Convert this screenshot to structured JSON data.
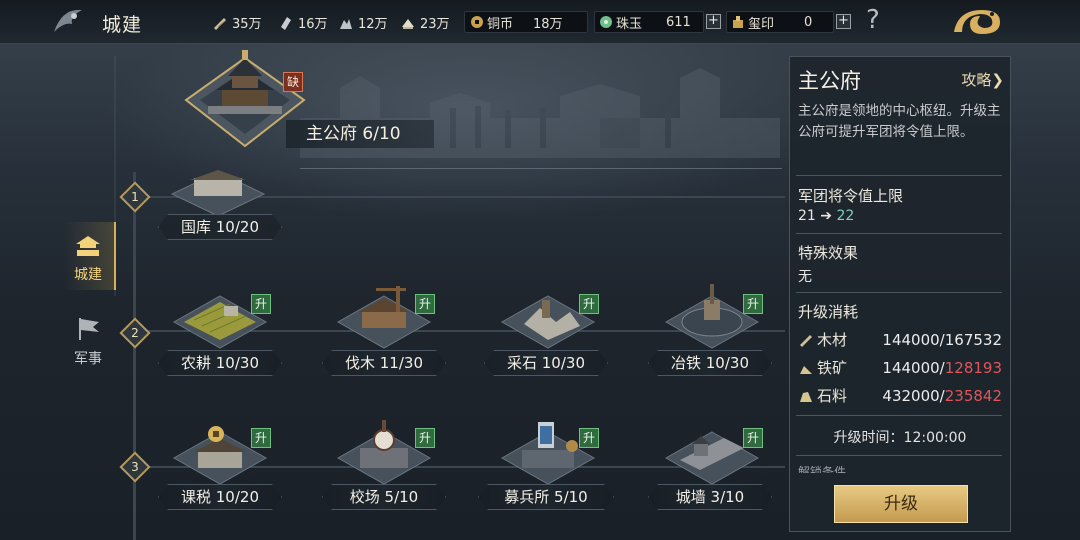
{
  "header": {
    "title": "城建",
    "resources": [
      {
        "icon": "wood-icon",
        "value": "35万"
      },
      {
        "icon": "iron-icon",
        "value": "16万"
      },
      {
        "icon": "stone-icon",
        "value": "12万"
      },
      {
        "icon": "grain-icon",
        "value": "23万"
      }
    ],
    "copper": {
      "label": "铜币",
      "value": "18万"
    },
    "jade": {
      "label": "珠玉",
      "value": "611"
    },
    "seal": {
      "label": "玺印",
      "value": "0"
    },
    "plus": "+",
    "help": "?"
  },
  "tabs": [
    {
      "label": "城建",
      "icon": "city-icon",
      "active": true
    },
    {
      "label": "军事",
      "icon": "flag-icon",
      "active": false
    }
  ],
  "main_building": {
    "label": "主公府 6/10",
    "badge": "缺"
  },
  "tiers": [
    "1",
    "2",
    "3"
  ],
  "buildings": [
    {
      "label": "国库 10/20",
      "badge": ""
    },
    {
      "label": "农耕 10/30",
      "badge": "升"
    },
    {
      "label": "伐木 11/30",
      "badge": "升"
    },
    {
      "label": "采石 10/30",
      "badge": "升"
    },
    {
      "label": "冶铁 10/30",
      "badge": "升"
    },
    {
      "label": "课税 10/20",
      "badge": "升"
    },
    {
      "label": "校场 5/10",
      "badge": "升"
    },
    {
      "label": "募兵所 5/10",
      "badge": "升"
    },
    {
      "label": "城墙 3/10",
      "badge": "升"
    }
  ],
  "panel": {
    "title": "主公府",
    "guide": "攻略",
    "guide_arrow": "❯",
    "description": "主公府是领地的中心枢纽。升级主公府可提升军团将令值上限。",
    "stat_heading": "军团将令值上限",
    "stat_from": "21",
    "stat_arrow": "➔",
    "stat_to": "22",
    "effect_heading": "特殊效果",
    "effect_value": "无",
    "cost_heading": "升级消耗",
    "costs": [
      {
        "icon": "wood-icon",
        "name": "木材",
        "have": "144000",
        "need": "167532",
        "short": false
      },
      {
        "icon": "iron-icon",
        "name": "铁矿",
        "have": "144000",
        "need": "128193",
        "short": true
      },
      {
        "icon": "stone-icon",
        "name": "石料",
        "have": "432000",
        "need": "235842",
        "short": true
      }
    ],
    "sep": "/",
    "time_label": "升级时间：12:00:00",
    "cut_text": "解锁条件",
    "button": "升级"
  },
  "colors": {
    "accent": "#d6b15a",
    "upgrade_badge": "#2f6b3e",
    "shortage": "#e0555a",
    "button": "#dcb76c"
  }
}
